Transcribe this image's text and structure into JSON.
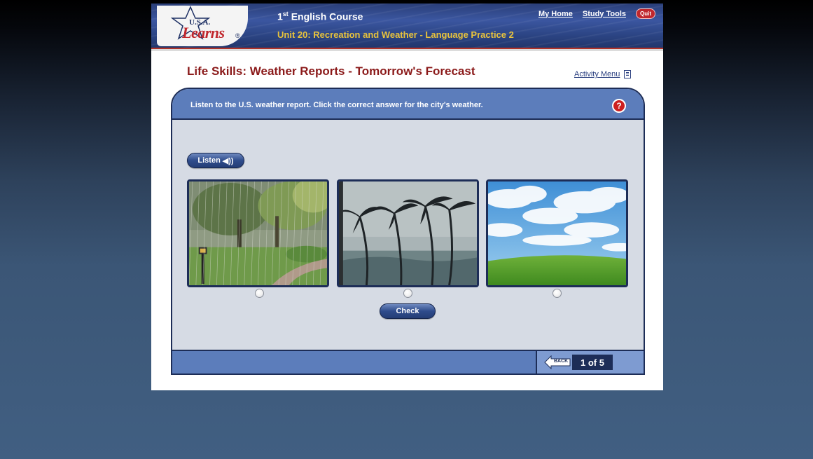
{
  "header": {
    "logo_usa": "U.S.A.",
    "logo_learns": "Learns",
    "logo_reg": "®",
    "course_number": "1",
    "course_sup": "st",
    "course_title": "English Course",
    "unit_title": "Unit 20: Recreation and Weather - Language Practice 2",
    "links": {
      "my_home": "My Home",
      "study_tools": "Study Tools",
      "quit": "Quit"
    }
  },
  "page": {
    "title": "Life Skills: Weather Reports - Tomorrow's Forecast",
    "activity_menu": "Activity Menu"
  },
  "activity": {
    "instruction": "Listen to the U.S. weather report. Click the correct answer for the city's weather.",
    "help_label": "?",
    "listen_label": "Listen",
    "speaker_glyph": "◀))",
    "options": [
      {
        "scene": "rainy-park-icon"
      },
      {
        "scene": "windy-palm-trees-icon"
      },
      {
        "scene": "sunny-cloudy-sky-icon"
      }
    ],
    "check_label": "Check"
  },
  "footer": {
    "back_label": "BACK",
    "page_counter": "1 of 5"
  }
}
